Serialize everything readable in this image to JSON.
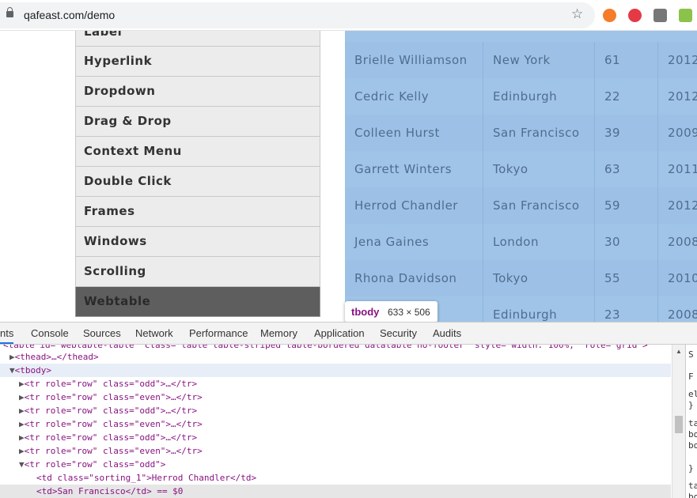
{
  "browser": {
    "url": "qafeast.com/demo"
  },
  "menu": {
    "items": [
      {
        "label": "Label"
      },
      {
        "label": "Hyperlink"
      },
      {
        "label": "Dropdown"
      },
      {
        "label": "Drag & Drop"
      },
      {
        "label": "Context Menu"
      },
      {
        "label": "Double Click"
      },
      {
        "label": "Frames"
      },
      {
        "label": "Windows"
      },
      {
        "label": "Scrolling"
      },
      {
        "label": "Webtable"
      }
    ]
  },
  "table": {
    "rows": [
      [
        "Brielle Williamson",
        "New York",
        "61",
        "2012"
      ],
      [
        "Cedric Kelly",
        "Edinburgh",
        "22",
        "2012"
      ],
      [
        "Colleen Hurst",
        "San Francisco",
        "39",
        "2009"
      ],
      [
        "Garrett Winters",
        "Tokyo",
        "63",
        "2011"
      ],
      [
        "Herrod Chandler",
        "San Francisco",
        "59",
        "2012"
      ],
      [
        "Jena Gaines",
        "London",
        "30",
        "2008"
      ],
      [
        "Rhona Davidson",
        "Tokyo",
        "55",
        "2010"
      ],
      [
        "",
        "Edinburgh",
        "23",
        "2008"
      ]
    ]
  },
  "tooltip": {
    "tag": "tbody",
    "size": "633 × 506"
  },
  "devtools": {
    "tabs": [
      "nts",
      "Console",
      "Sources",
      "Network",
      "Performance",
      "Memory",
      "Application",
      "Security",
      "Audits"
    ],
    "lines": {
      "table_open": "<table id=\"webtable-table\" class=\"table table-striped table-bordered datatable no-footer\" style=\"width: 100%;\" role=\"grid\">",
      "thead": "<thead>…</thead>",
      "tbody": "<tbody>",
      "rows": [
        "<tr role=\"row\" class=\"odd\">…</tr>",
        "<tr role=\"row\" class=\"even\">…</tr>",
        "<tr role=\"row\" class=\"odd\">…</tr>",
        "<tr role=\"row\" class=\"even\">…</tr>",
        "<tr role=\"row\" class=\"odd\">…</tr>",
        "<tr role=\"row\" class=\"even\">…</tr>",
        "<tr role=\"row\" class=\"odd\">"
      ],
      "td1": "<td class=\"sorting_1\">Herrod Chandler</td>",
      "td2": "<td>San Francisco</td> == $0"
    },
    "side_lines": [
      "S",
      "F",
      "el",
      "}",
      "ta",
      "bo",
      "bo",
      "}",
      "ta",
      "bo"
    ]
  }
}
